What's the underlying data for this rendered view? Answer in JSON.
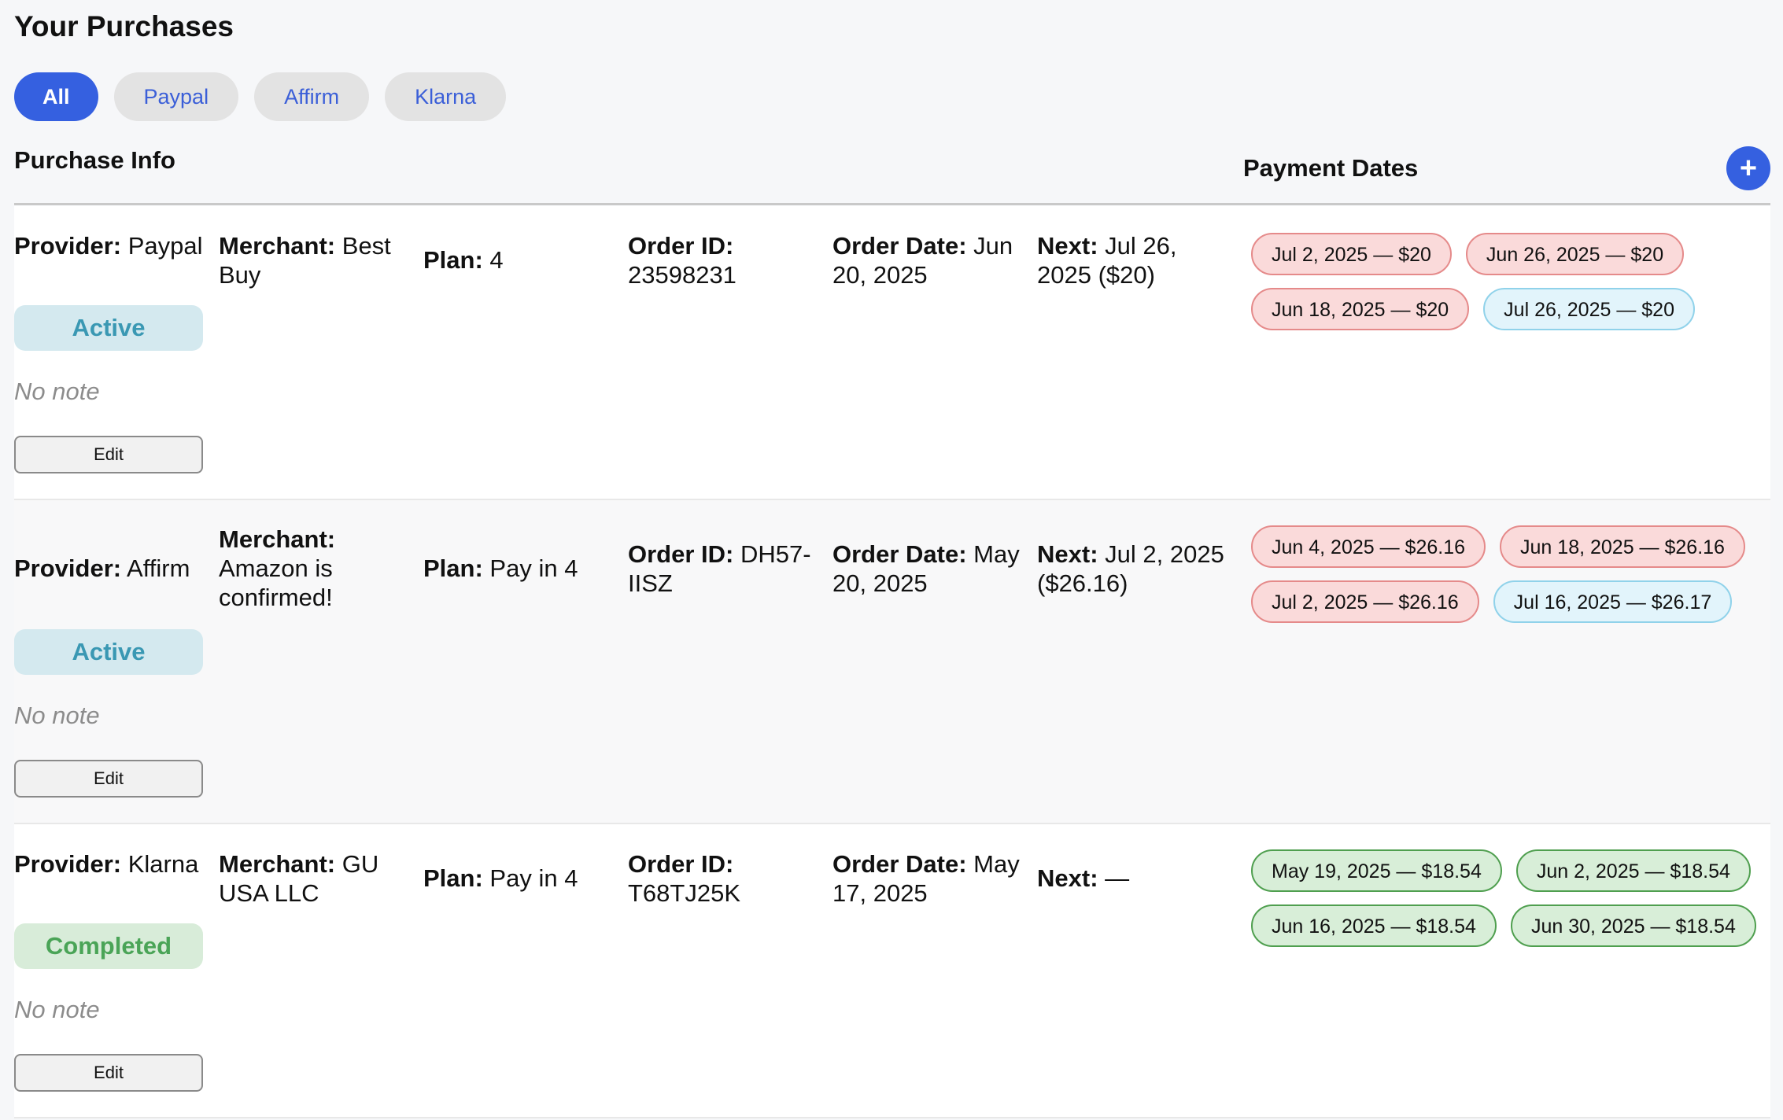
{
  "page": {
    "title": "Your Purchases"
  },
  "filters": [
    {
      "label": "All",
      "active": true
    },
    {
      "label": "Paypal",
      "active": false
    },
    {
      "label": "Affirm",
      "active": false
    },
    {
      "label": "Klarna",
      "active": false
    }
  ],
  "columns": {
    "info": "Purchase Info",
    "dates": "Payment Dates",
    "add_icon": "plus-icon",
    "add_glyph": "+"
  },
  "labels": {
    "provider": "Provider:",
    "merchant": "Merchant:",
    "plan": "Plan:",
    "order_id": "Order ID:",
    "order_date": "Order Date:",
    "next": "Next:",
    "edit": "Edit"
  },
  "colors": {
    "accent": "#3560e0",
    "active_status": "#3a98b3",
    "completed_status": "#4aa457",
    "paid_chip": "#e58a8a",
    "upcoming_chip": "#90d2ea",
    "completed_chip": "#4f9f4f"
  },
  "purchases": [
    {
      "provider": "Paypal",
      "merchant": "Best Buy",
      "plan": "4",
      "order_id": "23598231",
      "order_date": "Jun 20, 2025",
      "next": "Jul 26, 2025 ($20)",
      "status": "Active",
      "note": "No note",
      "payments": [
        {
          "label": "Jul 2, 2025 — $20",
          "state": "paid"
        },
        {
          "label": "Jun 26, 2025 — $20",
          "state": "paid"
        },
        {
          "label": "Jun 18, 2025 — $20",
          "state": "paid"
        },
        {
          "label": "Jul 26, 2025 — $20",
          "state": "upcoming"
        }
      ]
    },
    {
      "provider": "Affirm",
      "merchant": "Amazon is confirmed!",
      "plan": "Pay in 4",
      "order_id": "DH57-IISZ",
      "order_date": "May 20, 2025",
      "next": "Jul 2, 2025 ($26.16)",
      "status": "Active",
      "note": "No note",
      "payments": [
        {
          "label": "Jun 4, 2025 — $26.16",
          "state": "paid"
        },
        {
          "label": "Jun 18, 2025 — $26.16",
          "state": "paid"
        },
        {
          "label": "Jul 2, 2025 — $26.16",
          "state": "paid"
        },
        {
          "label": "Jul 16, 2025 — $26.17",
          "state": "upcoming"
        }
      ]
    },
    {
      "provider": "Klarna",
      "merchant": "GU USA LLC",
      "plan": "Pay in 4",
      "order_id": "T68TJ25K",
      "order_date": "May 17, 2025",
      "next": "—",
      "status": "Completed",
      "note": "No note",
      "payments": [
        {
          "label": "May 19, 2025 — $18.54",
          "state": "done"
        },
        {
          "label": "Jun 2, 2025 — $18.54",
          "state": "done"
        },
        {
          "label": "Jun 16, 2025 — $18.54",
          "state": "done"
        },
        {
          "label": "Jun 30, 2025 — $18.54",
          "state": "done"
        }
      ]
    }
  ]
}
